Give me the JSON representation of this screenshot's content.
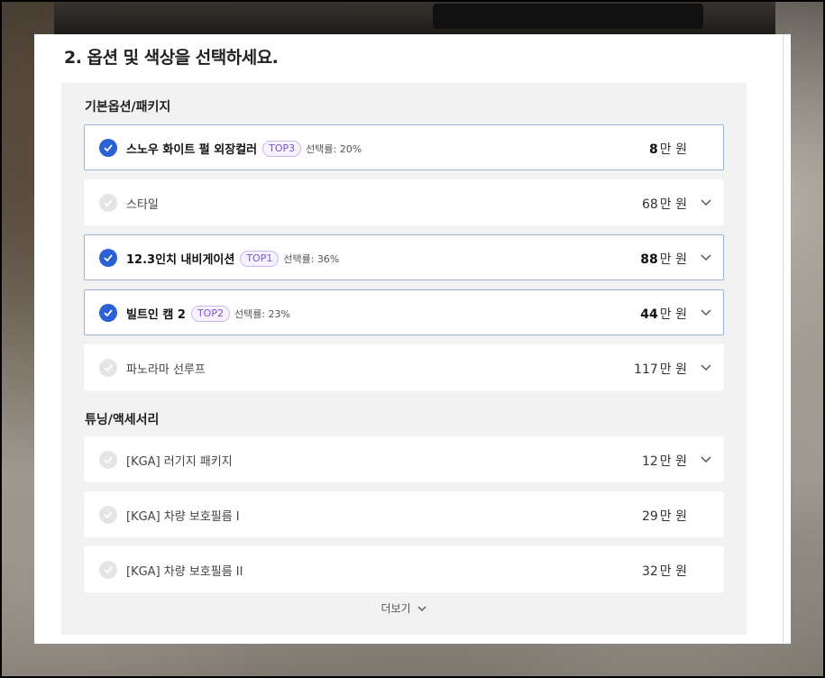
{
  "section": {
    "title": "2. 옵션 및 색상을 선택하세요."
  },
  "groups": [
    {
      "label": "기본옵션/패키지",
      "items": [
        {
          "name": "스노우 화이트 펄 외장컬러",
          "badge": "TOP3",
          "rate": "선택률: 20%",
          "price": "8",
          "unit": "만 원",
          "selected": true,
          "expandable": false
        },
        {
          "name": "스타일",
          "badge": "",
          "rate": "",
          "price": "68",
          "unit": "만 원",
          "selected": false,
          "expandable": true
        },
        {
          "name": "12.3인치 내비게이션",
          "badge": "TOP1",
          "rate": "선택률: 36%",
          "price": "88",
          "unit": "만 원",
          "selected": true,
          "expandable": true
        },
        {
          "name": "빌트인 캠 2",
          "badge": "TOP2",
          "rate": "선택률: 23%",
          "price": "44",
          "unit": "만 원",
          "selected": true,
          "expandable": true
        },
        {
          "name": "파노라마 선루프",
          "badge": "",
          "rate": "",
          "price": "117",
          "unit": "만 원",
          "selected": false,
          "expandable": true
        }
      ]
    },
    {
      "label": "튜닝/액세서리",
      "items": [
        {
          "name": "[KGA] 러기지 패키지",
          "badge": "",
          "rate": "",
          "price": "12",
          "unit": "만 원",
          "selected": false,
          "expandable": true
        },
        {
          "name": "[KGA] 차량 보호필름 I",
          "badge": "",
          "rate": "",
          "price": "29",
          "unit": "만 원",
          "selected": false,
          "expandable": false
        },
        {
          "name": "[KGA] 차량 보호필름 II",
          "badge": "",
          "rate": "",
          "price": "32",
          "unit": "만 원",
          "selected": false,
          "expandable": false
        }
      ]
    }
  ],
  "more_label": "더보기",
  "colors": {
    "accent": "#2a62d6",
    "badge": "#7b55c7",
    "selected_border": "#9bb3de"
  }
}
